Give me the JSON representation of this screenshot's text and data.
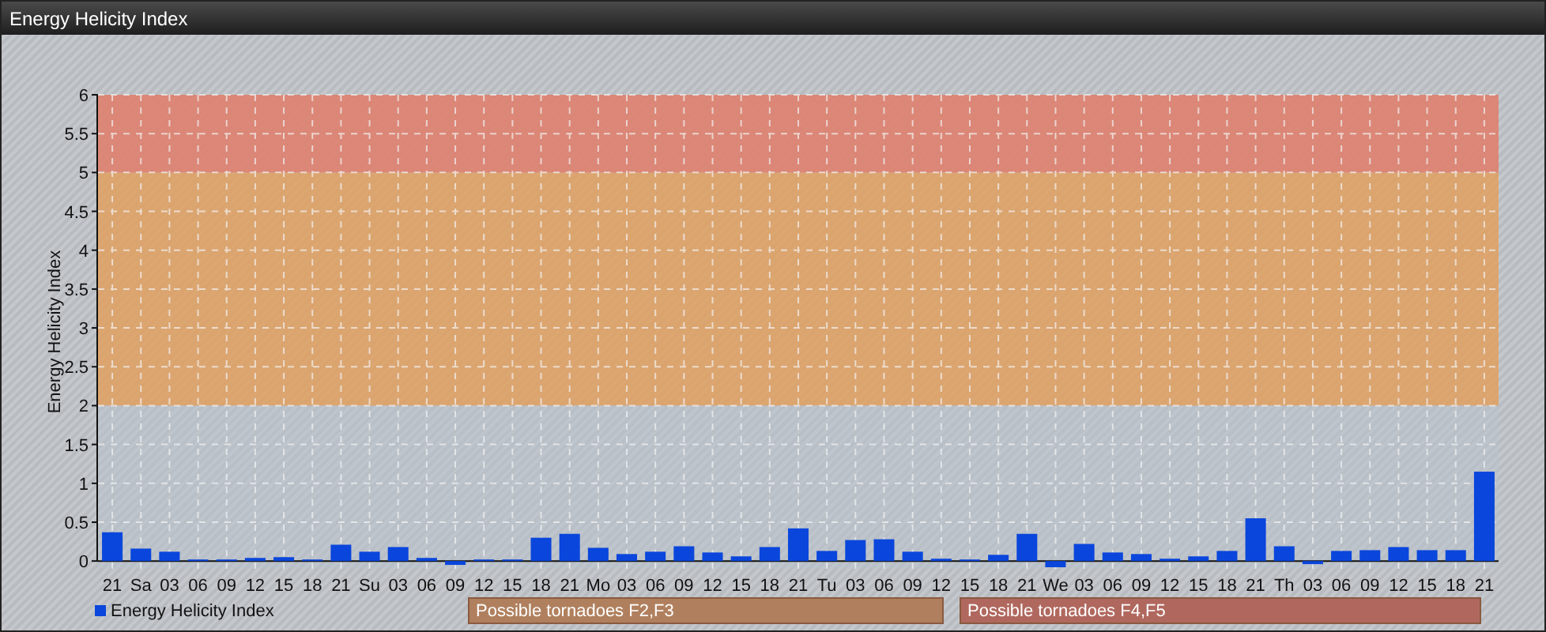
{
  "window": {
    "title": "Energy Helicity Index"
  },
  "chart_data": {
    "type": "bar",
    "ylabel": "Energy Helicity Index",
    "categories": [
      "21",
      "Sa",
      "03",
      "06",
      "09",
      "12",
      "15",
      "18",
      "21",
      "Su",
      "03",
      "06",
      "09",
      "12",
      "15",
      "18",
      "21",
      "Mo",
      "03",
      "06",
      "09",
      "12",
      "15",
      "18",
      "21",
      "Tu",
      "03",
      "06",
      "09",
      "12",
      "15",
      "18",
      "21",
      "We",
      "03",
      "06",
      "09",
      "12",
      "15",
      "18",
      "21",
      "Th",
      "03",
      "06",
      "09",
      "12",
      "15",
      "18",
      "21"
    ],
    "series": [
      {
        "name": "Energy Helicity Index",
        "color": "#0a46dc",
        "values": [
          0.37,
          0.16,
          0.12,
          0.02,
          0.02,
          0.04,
          0.05,
          0.02,
          0.21,
          0.12,
          0.18,
          0.04,
          -0.05,
          0.02,
          0.02,
          0.3,
          0.35,
          0.17,
          0.09,
          0.12,
          0.19,
          0.11,
          0.06,
          0.18,
          0.42,
          0.13,
          0.27,
          0.28,
          0.12,
          0.03,
          0.02,
          0.08,
          0.35,
          -0.08,
          0.22,
          0.11,
          0.09,
          0.03,
          0.06,
          0.13,
          0.55,
          0.19,
          -0.04,
          0.13,
          0.14,
          0.18,
          0.14,
          0.14,
          1.15
        ]
      }
    ],
    "ylim": [
      -0.1,
      6
    ],
    "grid": true,
    "yticks": [
      0,
      0.5,
      1,
      1.5,
      2,
      2.5,
      3,
      3.5,
      4,
      4.5,
      5,
      5.5,
      6
    ],
    "bands": [
      {
        "axis": "y",
        "from": 2,
        "to": 5,
        "color": "#e0a060"
      },
      {
        "axis": "y",
        "from": 5,
        "to": 6,
        "color": "#e07c68"
      }
    ]
  },
  "zones": [
    {
      "label": "Possible tornadoes F2,F3",
      "color": "#b0805e"
    },
    {
      "label": "Possible tornadoes F4,F5",
      "color": "#b0685e"
    }
  ]
}
